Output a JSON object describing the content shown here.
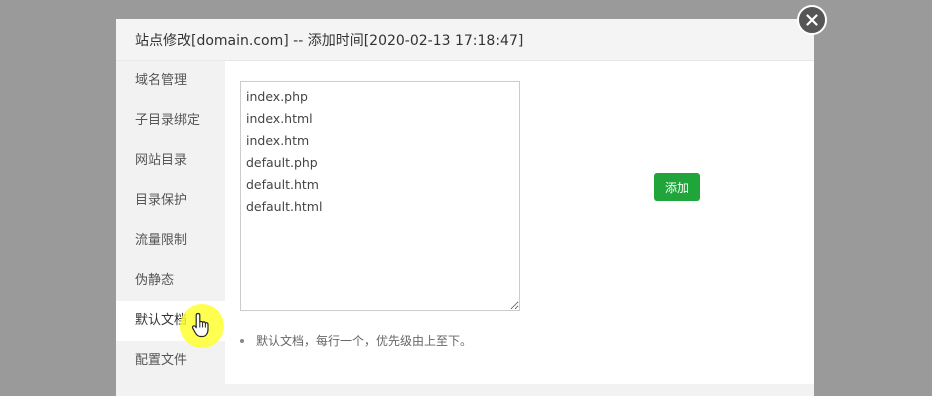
{
  "dialog": {
    "title": "站点修改[domain.com] -- 添加时间[2020-02-13 17:18:47]",
    "close_icon": "close-icon"
  },
  "sidebar": {
    "items": [
      {
        "label": "域名管理",
        "active": false
      },
      {
        "label": "子目录绑定",
        "active": false
      },
      {
        "label": "网站目录",
        "active": false
      },
      {
        "label": "目录保护",
        "active": false
      },
      {
        "label": "流量限制",
        "active": false
      },
      {
        "label": "伪静态",
        "active": false
      },
      {
        "label": "默认文档",
        "active": true
      },
      {
        "label": "配置文件",
        "active": false
      }
    ]
  },
  "default_docs": {
    "files_text": "index.php\nindex.html\nindex.htm\ndefault.php\ndefault.htm\ndefault.html",
    "add_button_label": "添加",
    "tip": "默认文档，每行一个，优先级由上至下。"
  },
  "colors": {
    "accent": "#20a53a",
    "overlay": "#9a9a9a",
    "cursor_highlight": "#ffff28"
  },
  "cursor": {
    "icon": "hand-pointer-icon"
  }
}
